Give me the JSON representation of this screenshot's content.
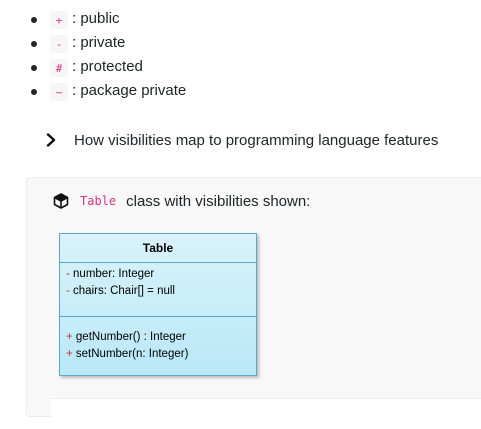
{
  "visibilities": [
    {
      "symbol": "+",
      "label": ": public"
    },
    {
      "symbol": "-",
      "label": ": private"
    },
    {
      "symbol": "#",
      "label": ": protected"
    },
    {
      "symbol": "~",
      "label": ": package private"
    }
  ],
  "details": {
    "summary": "How visibilities map to programming language features",
    "icon": "chevron-right-icon"
  },
  "panel": {
    "icon": "cube-icon",
    "code": "Table",
    "text": "class with visibilities shown:"
  },
  "uml": {
    "class_name": "Table",
    "attributes": [
      {
        "symbol": "-",
        "text": " number: Integer"
      },
      {
        "symbol": "-",
        "text": " chairs: Chair[] = null"
      }
    ],
    "operations": [
      {
        "symbol": "+",
        "text": " getNumber() : Integer"
      },
      {
        "symbol": "+",
        "text": " setNumber(n: Integer)"
      }
    ]
  },
  "colors": {
    "code_text": "#d63384",
    "uml_border": "#5aa8c8",
    "uml_fill": "#c8eef9",
    "uml_symbol": "#c0392b"
  }
}
